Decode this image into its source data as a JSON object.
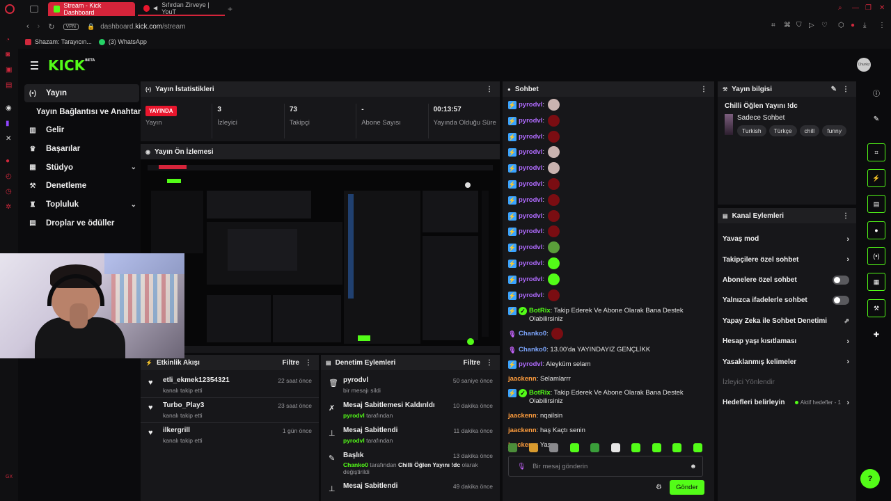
{
  "browser": {
    "tabs": [
      {
        "label": "Stream - Kick Dashboard",
        "active": true
      },
      {
        "label": "Sıfırdan Zirveye | YouT",
        "active": false
      }
    ],
    "url_prefix": "dashboard.",
    "url_domain": "kick.com",
    "url_path": "/stream",
    "vpn_label": "VPN",
    "bookmarks": [
      {
        "label": "Shazam: Tarayıcın...",
        "icon": "shazam-icon"
      },
      {
        "label": "(3) WhatsApp",
        "icon": "whatsapp-icon"
      }
    ]
  },
  "app": {
    "logo": "KICK",
    "logo_beta": "BETA",
    "avatar_text": "Chunkz",
    "accent": "#53fc18"
  },
  "sidenav": {
    "items": [
      {
        "label": "Yayın",
        "icon": "stream-icon"
      },
      {
        "label": "Yayın Bağlantısı ve Anahtarı",
        "icon": ""
      },
      {
        "label": "Gelir",
        "icon": "chart-icon"
      },
      {
        "label": "Başarılar",
        "icon": "trophy-icon"
      },
      {
        "label": "Stüdyo",
        "icon": "studio-icon"
      },
      {
        "label": "Denetleme",
        "icon": "wrench-icon"
      },
      {
        "label": "Topluluk",
        "icon": "community-icon"
      },
      {
        "label": "Droplar ve ödüller",
        "icon": "gift-icon"
      }
    ]
  },
  "stats": {
    "title": "Yayın İstatistikleri",
    "live_badge": "YAYINDA",
    "live_label": "Yayın",
    "items": [
      {
        "value": "3",
        "label": "İzleyici"
      },
      {
        "value": "73",
        "label": "Takipçi"
      },
      {
        "value": "-",
        "label": "Abone Sayısı"
      },
      {
        "value": "00:13:57",
        "label": "Yayında Olduğu Süre"
      }
    ]
  },
  "preview": {
    "title": "Yayın Ön İzlemesi"
  },
  "activity": {
    "title": "Etkinlik Akışı",
    "filter": "Filtre",
    "items": [
      {
        "name": "etli_ekmek12354321",
        "desc": "kanalı takip etti",
        "time": "22 saat önce"
      },
      {
        "name": "Turbo_Play3",
        "desc": "kanalı takip etti",
        "time": "23 saat önce"
      },
      {
        "name": "ilkergrill",
        "desc": "kanalı takip etti",
        "time": "1 gün önce"
      }
    ]
  },
  "moderation": {
    "title": "Denetim Eylemleri",
    "filter": "Filtre",
    "items": [
      {
        "title": "pyrodvl",
        "user": "",
        "desc": "bir mesajı sildi",
        "time": "50 saniye önce",
        "icon": "trash-icon"
      },
      {
        "title": "Mesaj Sabitlemesi Kaldırıldı",
        "user": "pyrodvl",
        "desc": "tarafından",
        "time": "10 dakika önce",
        "icon": "unpin-icon"
      },
      {
        "title": "Mesaj Sabitlendi",
        "user": "pyrodvl",
        "desc": "tarafından",
        "time": "11 dakika önce",
        "icon": "pin-icon"
      },
      {
        "title": "Başlık",
        "user": "Chanko0",
        "desc": "tarafından",
        "extra": "Chilli Öğlen Yayını !dc",
        "desc2": "olarak değiştirildi",
        "time": "13 dakika önce",
        "icon": "title-icon"
      },
      {
        "title": "Mesaj Sabitlendi",
        "user": "",
        "desc": "",
        "time": "49 dakika önce",
        "icon": "pin-icon"
      }
    ]
  },
  "chat": {
    "title": "Sohbet",
    "messages": [
      {
        "user": "pyrodvl",
        "text": "",
        "emote": "#c9b3b0"
      },
      {
        "user": "pyrodvl",
        "text": "",
        "emote": "#7a0d12"
      },
      {
        "user": "pyrodvl",
        "text": "",
        "emote": "#7a0d12"
      },
      {
        "user": "pyrodvl",
        "text": "",
        "emote": "#c9b3b0"
      },
      {
        "user": "pyrodvl",
        "text": "",
        "emote": "#c9b3b0"
      },
      {
        "user": "pyrodvl",
        "text": "",
        "emote": "#7a0d12"
      },
      {
        "user": "pyrodvl",
        "text": "",
        "emote": "#7a0d12"
      },
      {
        "user": "pyrodvl",
        "text": "",
        "emote": "#7a0d12"
      },
      {
        "user": "pyrodvl",
        "text": "",
        "emote": "#7a0d12"
      },
      {
        "user": "pyrodvl",
        "text": "",
        "emote": "#5a9e3a"
      },
      {
        "user": "pyrodvl",
        "text": "",
        "emote": "#53fc18"
      },
      {
        "user": "pyrodvl",
        "text": "",
        "emote": "#53fc18"
      },
      {
        "user": "pyrodvl",
        "text": "",
        "emote": "#7a0d12"
      },
      {
        "user": "BotRix",
        "text": "Takip Ederek Ve Abone Olarak Bana Destek Olabilirsiniz"
      },
      {
        "user": "Chanko0",
        "text": "",
        "emote": "#7a0d12"
      },
      {
        "user": "Chanko0",
        "text": "13.00'da YAYINDAYIZ GENÇLİKK"
      },
      {
        "user": "pyrodvl",
        "text": "Aleyküm selam"
      },
      {
        "user": "jaackenn",
        "text": "Selamlarrr"
      },
      {
        "user": "BotRix",
        "text": "Takip Ederek Ve Abone Olarak Bana Destek Olabilirsiniz"
      },
      {
        "user": "jaackenn",
        "text": "nqailsin"
      },
      {
        "user": "jaackenn",
        "text": "haş Kaçtı senin"
      },
      {
        "user": "jaackenn",
        "text": "Yaş"
      }
    ],
    "input_placeholder": "Bir mesaj gönderin",
    "send_label": "Gönder"
  },
  "stream_info": {
    "title": "Yayın bilgisi",
    "stream_title": "Chilli Öğlen Yayını !dc",
    "category": "Sadece Sohbet",
    "tags": [
      "Turkish",
      "Türkçe",
      "chill",
      "funny"
    ]
  },
  "channel_actions": {
    "title": "Kanal Eylemleri",
    "items": [
      {
        "label": "Yavaş mod",
        "kind": "arrow"
      },
      {
        "label": "Takipçilere özel sohbet",
        "kind": "arrow"
      },
      {
        "label": "Abonelere özel sohbet",
        "kind": "toggle"
      },
      {
        "label": "Yalnızca ifadelerle sohbet",
        "kind": "toggle"
      },
      {
        "label": "Yapay Zeka ile Sohbet Denetimi",
        "kind": "external"
      },
      {
        "label": "Hesap yaşı kısıtlaması",
        "kind": "arrow"
      },
      {
        "label": "Yasaklanmış kelimeler",
        "kind": "arrow"
      },
      {
        "label": "İzleyici Yönlendir",
        "kind": "disabled"
      },
      {
        "label": "Hedefleri belirleyin",
        "kind": "goal",
        "goal_text": "Aktif hedefler - 1"
      }
    ]
  }
}
